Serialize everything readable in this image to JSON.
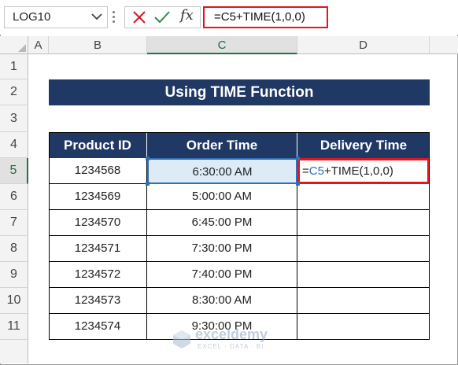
{
  "formula_bar": {
    "name_box": "LOG10",
    "fx_label": "fx",
    "formula": "=C5+TIME(1,0,0)"
  },
  "columns": [
    "A",
    "B",
    "C",
    "D"
  ],
  "rows": [
    "1",
    "2",
    "3",
    "4",
    "5",
    "6",
    "7",
    "8",
    "9",
    "10",
    "11"
  ],
  "sheet": {
    "title": "Using TIME Function",
    "headers": [
      "Product ID",
      "Order Time",
      "Delivery Time"
    ],
    "rows": [
      {
        "product_id": "1234568",
        "order_time": "6:30:00 AM",
        "delivery_time": ""
      },
      {
        "product_id": "1234569",
        "order_time": "5:00:00 AM",
        "delivery_time": ""
      },
      {
        "product_id": "1234570",
        "order_time": "6:45:00 PM",
        "delivery_time": ""
      },
      {
        "product_id": "1234571",
        "order_time": "7:30:00 PM",
        "delivery_time": ""
      },
      {
        "product_id": "1234572",
        "order_time": "7:40:00 PM",
        "delivery_time": ""
      },
      {
        "product_id": "1234573",
        "order_time": "8:30:00 AM",
        "delivery_time": ""
      },
      {
        "product_id": "1234574",
        "order_time": "9:30:00 PM",
        "delivery_time": ""
      }
    ],
    "editing": {
      "prefix": "=",
      "ref": "C5",
      "suffix": "+TIME(1,0,0)"
    }
  },
  "watermark": {
    "name": "exceldemy",
    "tagline": "EXCEL · DATA · BI"
  },
  "colors": {
    "header_fill": "#1f3864",
    "edit_highlight": "#e0161e",
    "selection": "#2f6fb3"
  }
}
